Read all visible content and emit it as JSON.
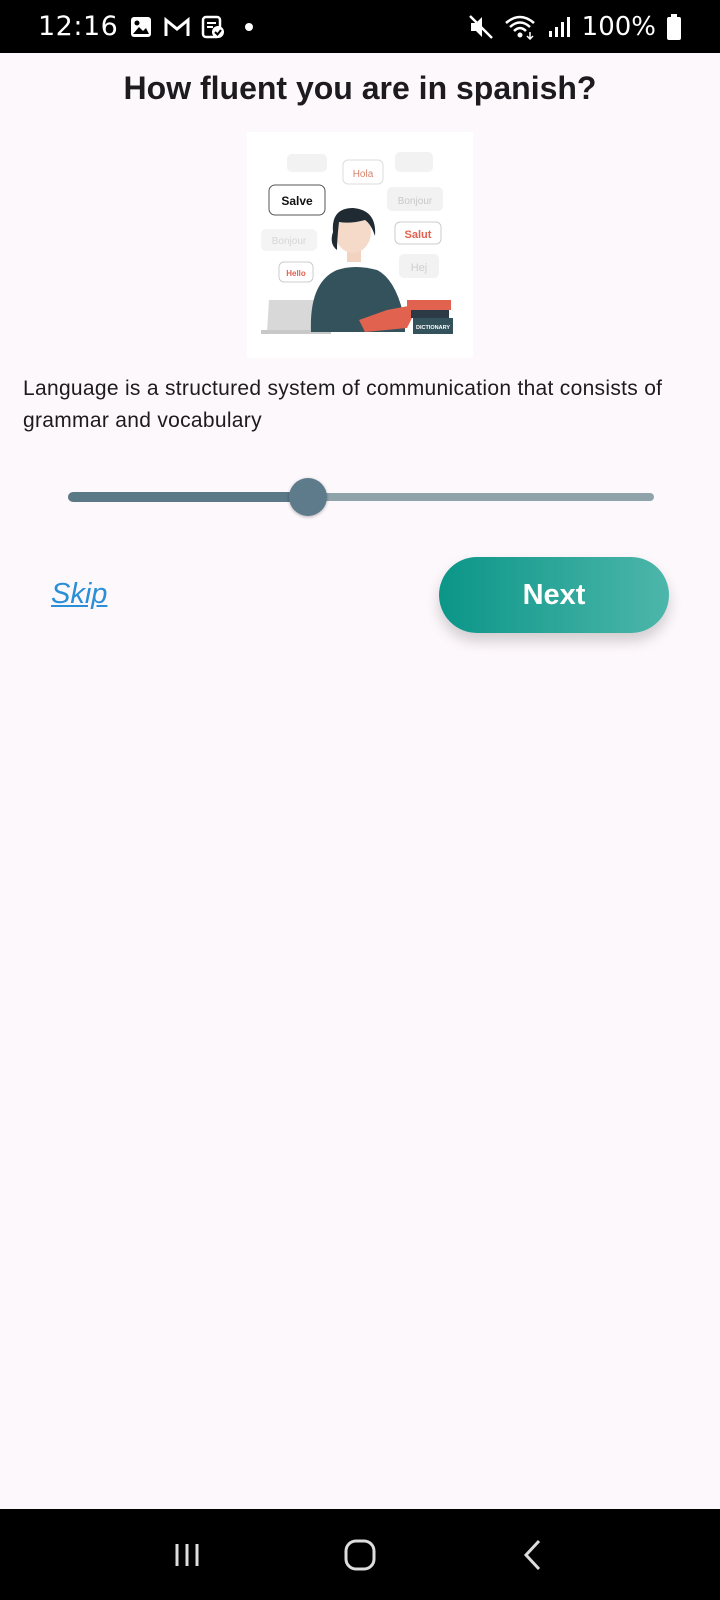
{
  "status_bar": {
    "time": "12:16",
    "battery": "100%",
    "icons_left": [
      "gallery-icon",
      "gmail-icon",
      "clipboard-check-icon",
      "dot-icon"
    ],
    "icons_right": [
      "mute-icon",
      "wifi-icon",
      "signal-icon",
      "battery-icon"
    ]
  },
  "page": {
    "title": "How fluent you are in spanish?",
    "description": "Language is a structured system of communication that consists of grammar and vocabulary",
    "illustration": {
      "bubbles": [
        "Hola",
        "Salve",
        "Bonjour",
        "Salut",
        "Bonjour",
        "Hej",
        "Hello"
      ],
      "book_label": "DICTIONARY"
    }
  },
  "slider": {
    "value_fraction": 0.41
  },
  "actions": {
    "skip_label": "Skip",
    "next_label": "Next"
  },
  "nav_bar": {
    "icons": [
      "recent-apps-icon",
      "home-icon",
      "back-icon"
    ]
  },
  "colors": {
    "background": "#FDF8FC",
    "accent_start": "#0b9688",
    "accent_end": "#4db6aa",
    "slider_active": "#5b7887",
    "slider_inactive": "#8fa3ab",
    "link": "#2a8fd6"
  }
}
